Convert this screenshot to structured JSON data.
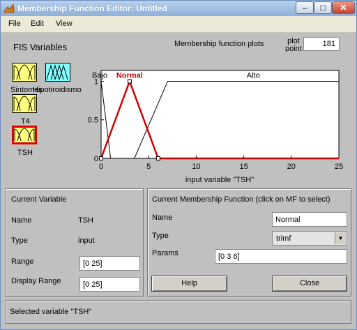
{
  "window": {
    "title": "Membership Function Editor: Untitled"
  },
  "menu": [
    "File",
    "Edit",
    "View"
  ],
  "fis_variables": {
    "heading": "FIS Variables",
    "items": [
      {
        "label": "Sintomas",
        "kind": "input",
        "selected": false
      },
      {
        "label": "Hipotiroidismo",
        "kind": "output",
        "selected": false
      },
      {
        "label": "T4",
        "kind": "input",
        "selected": false
      },
      {
        "label": "TSH",
        "kind": "input",
        "selected": true
      }
    ]
  },
  "plot": {
    "title": "Membership function plots",
    "plot_points_label": "plot points:",
    "plot_points_value": "181"
  },
  "chart_data": {
    "type": "line",
    "xlabel": "input variable \"TSH\"",
    "xlim": [
      0,
      25
    ],
    "ylim": [
      0,
      1
    ],
    "xticks": [
      "0",
      "5",
      "10",
      "15",
      "20",
      "25"
    ],
    "yticks": [
      "0",
      "0.5",
      "1"
    ],
    "series": [
      {
        "name": "Bajo",
        "points": [
          [
            0,
            1
          ],
          [
            0,
            1
          ],
          [
            1,
            0
          ]
        ],
        "selected": false
      },
      {
        "name": "Normal",
        "points": [
          [
            0,
            0
          ],
          [
            3,
            1
          ],
          [
            6,
            0
          ]
        ],
        "selected": true
      },
      {
        "name": "Alto",
        "points": [
          [
            3.5,
            0
          ],
          [
            7,
            1
          ],
          [
            25,
            1
          ]
        ],
        "selected": false
      }
    ],
    "colors": {
      "selected": "#cc0000",
      "normal": "#000000"
    }
  },
  "current_variable": {
    "heading": "Current Variable",
    "name_label": "Name",
    "name_value": "TSH",
    "type_label": "Type",
    "type_value": "input",
    "range_label": "Range",
    "range_value": "[0 25]",
    "display_range_label": "Display Range",
    "display_range_value": "[0 25]"
  },
  "current_mf": {
    "heading": "Current Membership Function (click on MF to select)",
    "name_label": "Name",
    "name_value": "Normal",
    "type_label": "Type",
    "type_value": "trimf",
    "params_label": "Params",
    "params_value": "[0 3 6]"
  },
  "buttons": {
    "help": "Help",
    "close": "Close"
  },
  "status": "Selected variable \"TSH\""
}
